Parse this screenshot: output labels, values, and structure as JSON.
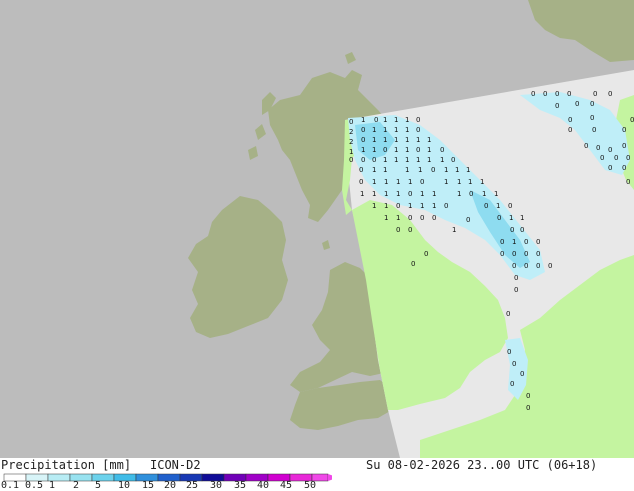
{
  "footer": {
    "title": "Precipitation [mm]",
    "model": "ICON-D2",
    "datetime": "Su 08-02-2026 23..00 UTC (06+18)"
  },
  "legend": {
    "ticks": [
      "0.1",
      "0.5",
      "1",
      "2",
      "5",
      "10",
      "15",
      "20",
      "25",
      "30",
      "35",
      "40",
      "45",
      "50"
    ],
    "colors": [
      "#ffffff",
      "#d8f4f8",
      "#b8ecf4",
      "#98e2f0",
      "#6cd2ec",
      "#40bce8",
      "#3090dc",
      "#2060cc",
      "#1838b4",
      "#100c98",
      "#7000b8",
      "#a000c8",
      "#d000d0",
      "#e828d8",
      "#f048e8"
    ]
  },
  "map": {
    "colors": {
      "sea_outside": "#bcbcbc",
      "land_outside": "#a6b187",
      "sea_domain": "#e8e8e8",
      "land_domain": "#c4f4a0",
      "precip_light": "#bfeef8",
      "precip_mid": "#8edcf0"
    },
    "values": [
      "0",
      "1",
      "0",
      "1",
      "1",
      "1",
      "0",
      "2",
      "0",
      "1",
      "1",
      "1",
      "1",
      "0",
      "2",
      "0",
      "1",
      "1",
      "1",
      "1",
      "1",
      "1",
      "1",
      "1",
      "1",
      "0",
      "1",
      "1",
      "0",
      "1",
      "0",
      "0",
      "0",
      "0",
      "1",
      "1",
      "1",
      "1",
      "1",
      "1",
      "0",
      "0",
      "1",
      "1",
      "1",
      "1",
      "0",
      "1",
      "1",
      "1",
      "0",
      "1",
      "1",
      "1",
      "1",
      "0",
      "1",
      "1",
      "1",
      "1",
      "1",
      "1",
      "1",
      "1",
      "0",
      "1",
      "1",
      "1",
      "0",
      "1",
      "1",
      "1",
      "1",
      "0",
      "1",
      "1",
      "1",
      "0",
      "0",
      "1",
      "0",
      "1",
      "1",
      "0",
      "0",
      "0",
      "0",
      "1",
      "1",
      "0",
      "0",
      "0",
      "0",
      "0",
      "1",
      "0",
      "0",
      "0",
      "0",
      "0",
      "0",
      "0",
      "0",
      "0",
      "0",
      "0",
      "0",
      "0",
      "0",
      "0",
      "0",
      "0",
      "0",
      "0",
      "0",
      "0",
      "0",
      "0",
      "0",
      "0",
      "0",
      "0",
      "0",
      "0",
      "0",
      "0",
      "0",
      "0",
      "0",
      "0",
      "0",
      "0",
      "0",
      "0",
      "0",
      "0",
      "0",
      "0",
      "0",
      "0"
    ]
  }
}
